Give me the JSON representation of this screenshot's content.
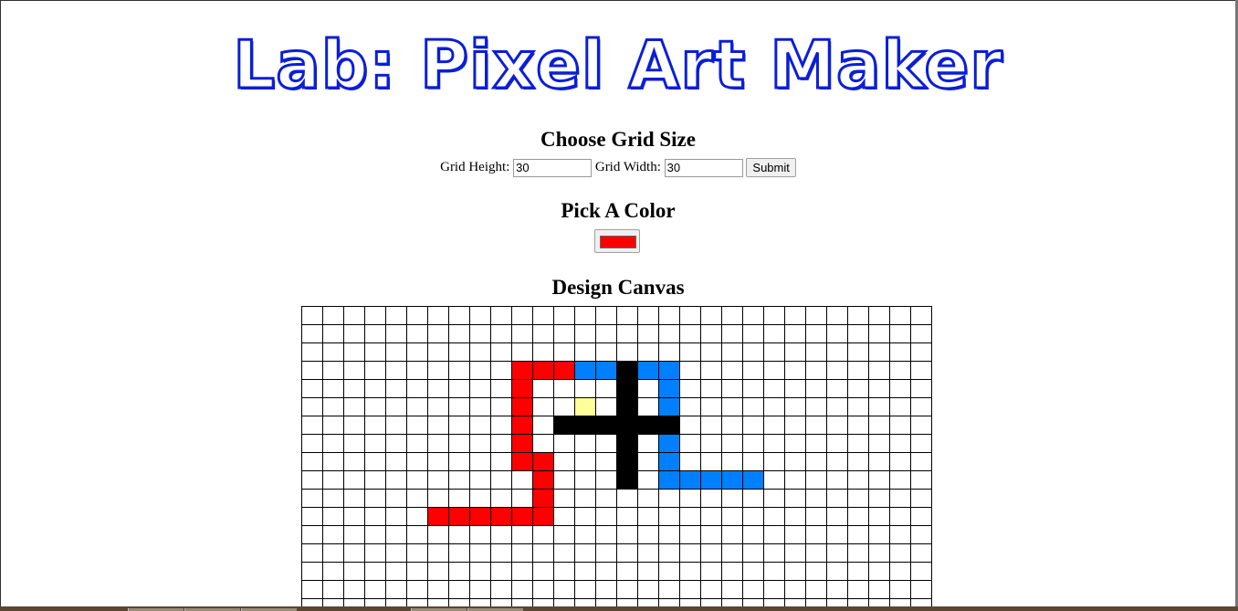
{
  "page": {
    "title": "Lab: Pixel Art Maker"
  },
  "grid_size": {
    "heading": "Choose Grid Size",
    "height_label": "Grid Height:",
    "height_value": "30",
    "width_label": "Grid Width:",
    "width_value": "30",
    "submit_label": "Submit"
  },
  "color": {
    "heading": "Pick A Color",
    "selected": "#ff0000"
  },
  "canvas": {
    "heading": "Design Canvas",
    "columns": 30,
    "visible_rows": 17,
    "palette": {
      "r": "#ff0000",
      "b": "#0080ff",
      "k": "#000000",
      "y": "#ffff99"
    },
    "painted_rows": [
      "..............................",
      "..............................",
      "..............................",
      "..........rrrbbkbb............",
      "..........r....k.b............",
      "..........r..y.k.b............",
      "..........r.kkkkkk............",
      "..........r....k.b............",
      "..........rr...k.b............",
      "...........r...k.bbbbb........",
      "...........r..................",
      "......rrrrrr..................",
      "..............................",
      "..............................",
      "..............................",
      "..............................",
      ".............................."
    ]
  }
}
